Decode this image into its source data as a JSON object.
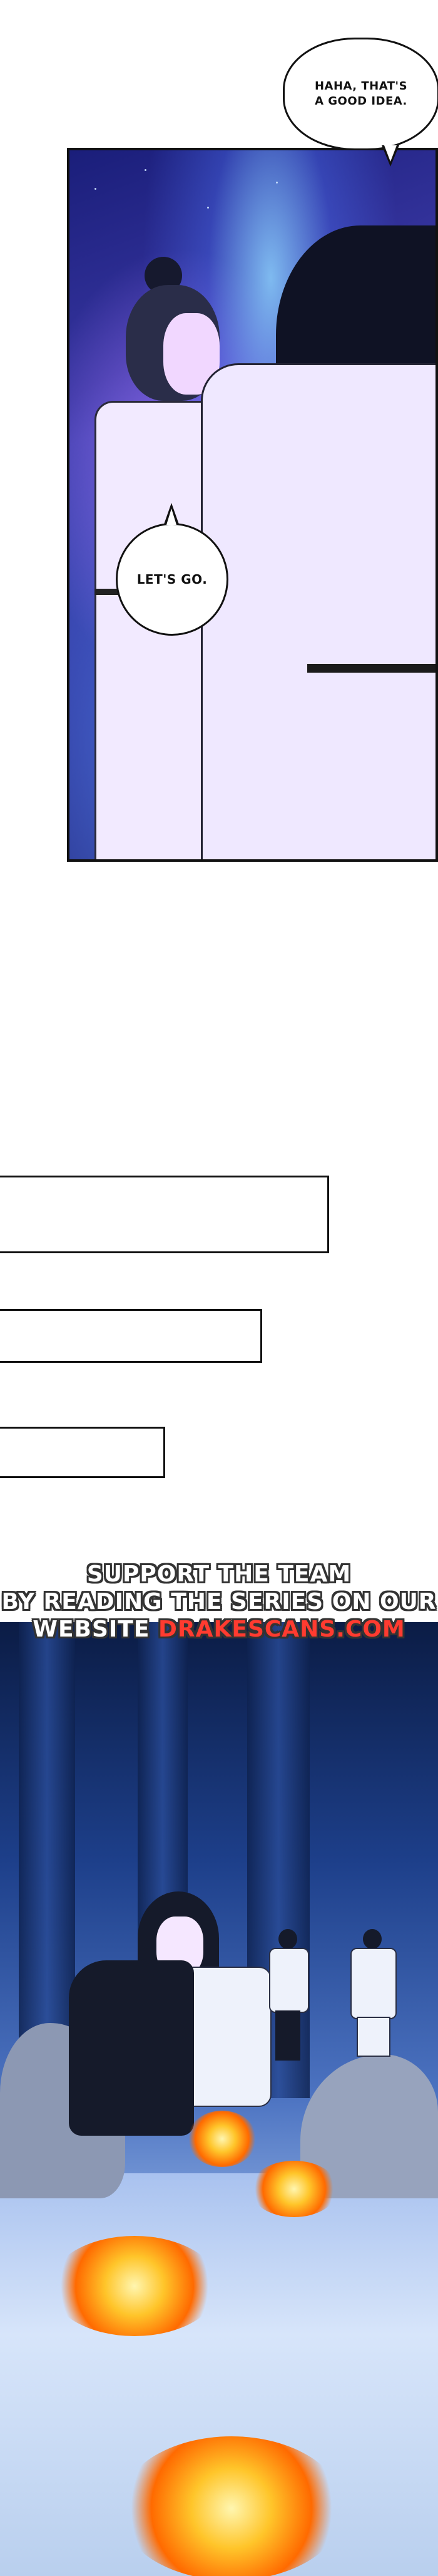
{
  "bubbles": {
    "top_right": "HAHA, THAT'S A GOOD IDEA.",
    "middle_left": "LET'S GO."
  },
  "promo": {
    "line1": "SUPPORT THE TEAM",
    "line2": "BY READING THE SERIES ON OUR",
    "line3_prefix": "WEBSITE",
    "line3_site": "DRAKESCANS.COM"
  },
  "colors": {
    "promo_accent": "#ff3b30",
    "sky_blue": "#3d3aa8",
    "flame_orange": "#ff6a00"
  }
}
